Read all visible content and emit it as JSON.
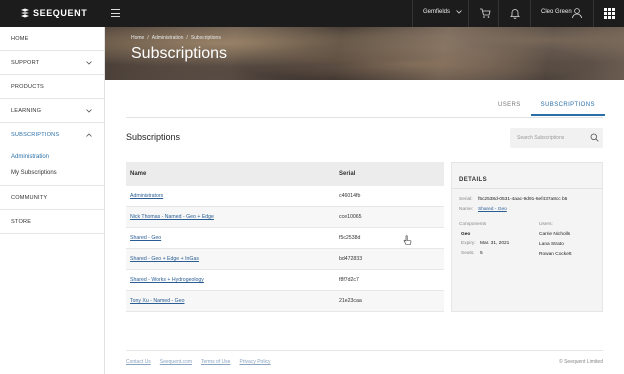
{
  "brand": {
    "name": "SEEQUENT"
  },
  "topbar": {
    "workspace": "Gemfields",
    "user_name": "Cleo Green"
  },
  "sidebar": {
    "items": [
      {
        "label": "HOME"
      },
      {
        "label": "SUPPORT"
      },
      {
        "label": "PRODUCTS"
      },
      {
        "label": "LEARNING"
      },
      {
        "label": "SUBSCRIPTIONS"
      }
    ],
    "subscriptions_sub": [
      {
        "label": "Administration"
      },
      {
        "label": "My Subscriptions"
      }
    ],
    "bottom_items": [
      {
        "label": "COMMUNITY"
      },
      {
        "label": "STORE"
      }
    ]
  },
  "hero": {
    "breadcrumb": [
      "Home",
      "/",
      "Administration",
      "/",
      "Subscriptions"
    ],
    "title": "Subscriptions"
  },
  "tabs": [
    {
      "label": "USERS"
    },
    {
      "label": "SUBSCRIPTIONS"
    }
  ],
  "section_title": "Subscriptions",
  "search": {
    "placeholder": "Search Subscriptions"
  },
  "table": {
    "columns": [
      "Name",
      "Serial"
    ],
    "rows": [
      {
        "name": "Administrators",
        "serial": "c46014fb"
      },
      {
        "name": "Nick Thomas - Named - Geo + Edge",
        "serial": "cce10065"
      },
      {
        "name": "Shared - Geo",
        "serial": "f5c2538d"
      },
      {
        "name": "Shared - Geo + Edge + InGas",
        "serial": "bd472833"
      },
      {
        "name": "Shared - Works + Hydrogeology",
        "serial": "f8f7d2c7"
      },
      {
        "name": "Tony Xu - Named - Geo",
        "serial": "21e23caa"
      }
    ]
  },
  "details": {
    "title": "DETAILS",
    "serial_label": "Serial:",
    "serial_value": "f5c2538d-0531-4aac-9d91-6ef437a8cc b5",
    "name_label": "Name:",
    "name_value": "Shared - Geo",
    "components_label": "Components",
    "users_label": "Users:",
    "component_name": "Geo",
    "expiry_label": "Expiry:",
    "expiry_value": "Mar. 31, 2021",
    "seats_label": "Seats:",
    "seats_value": "5",
    "users": [
      "Carrie Nicholls",
      "Lana Strato",
      "Rowan Cockett"
    ]
  },
  "footer": {
    "links": [
      "Contact Us",
      "Seequent.com",
      "Terms of Use",
      "Privacy Policy"
    ],
    "copyright": "© Seequent Limited"
  },
  "colors": {
    "accent": "#2b6fa8",
    "topbar": "#1c1c1c",
    "link": "#2a5d93"
  }
}
